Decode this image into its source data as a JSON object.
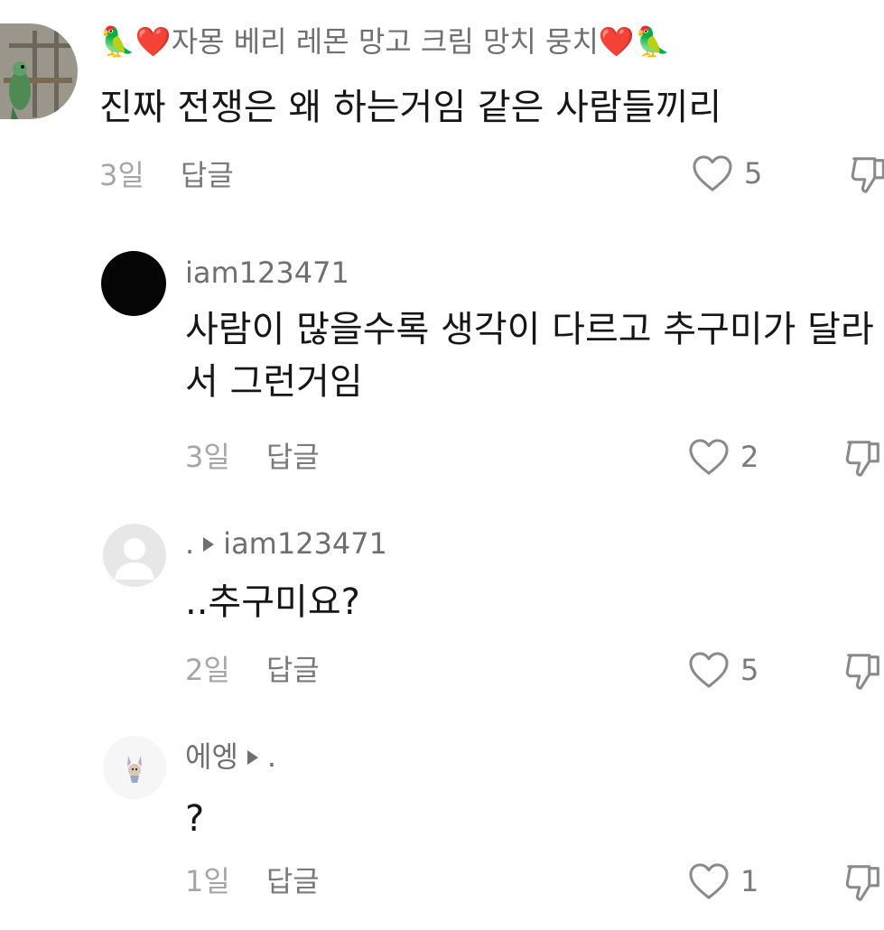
{
  "comments": [
    {
      "username": "🦜❤️자몽 베리 레몬 망고 크림 망치 뭉치❤️🦜",
      "reply_to": "",
      "text_lines": [
        "진짜 전쟁은 왜 하는거임 같은 사람들끼리"
      ],
      "time": "3일",
      "reply_label": "답글",
      "likes": "5",
      "avatar": "parrot-avatar"
    },
    {
      "username": "iam123471",
      "reply_to": "",
      "text_lines": [
        "사람이 많을수록 생각이 다르고 추구미가 달라",
        "서 그런거임"
      ],
      "time": "3일",
      "reply_label": "답글",
      "likes": "2",
      "avatar": "black-avatar"
    },
    {
      "username": ".",
      "reply_to": "iam123471",
      "text_lines": [
        "..추구미요?"
      ],
      "time": "2일",
      "reply_label": "답글",
      "likes": "5",
      "avatar": "default-avatar"
    },
    {
      "username": "에엥",
      "reply_to": ".",
      "text_lines": [
        "?"
      ],
      "time": "1일",
      "reply_label": "답글",
      "likes": "1",
      "avatar": "sticker-avatar"
    }
  ],
  "icons": {
    "like": "heart-outline-icon",
    "dislike": "thumbs-down-outline-icon"
  },
  "colors": {
    "text": "#161616",
    "username": "#6f6f6f",
    "meta": "#a6a6a6",
    "icon": "#8a8a8a"
  }
}
